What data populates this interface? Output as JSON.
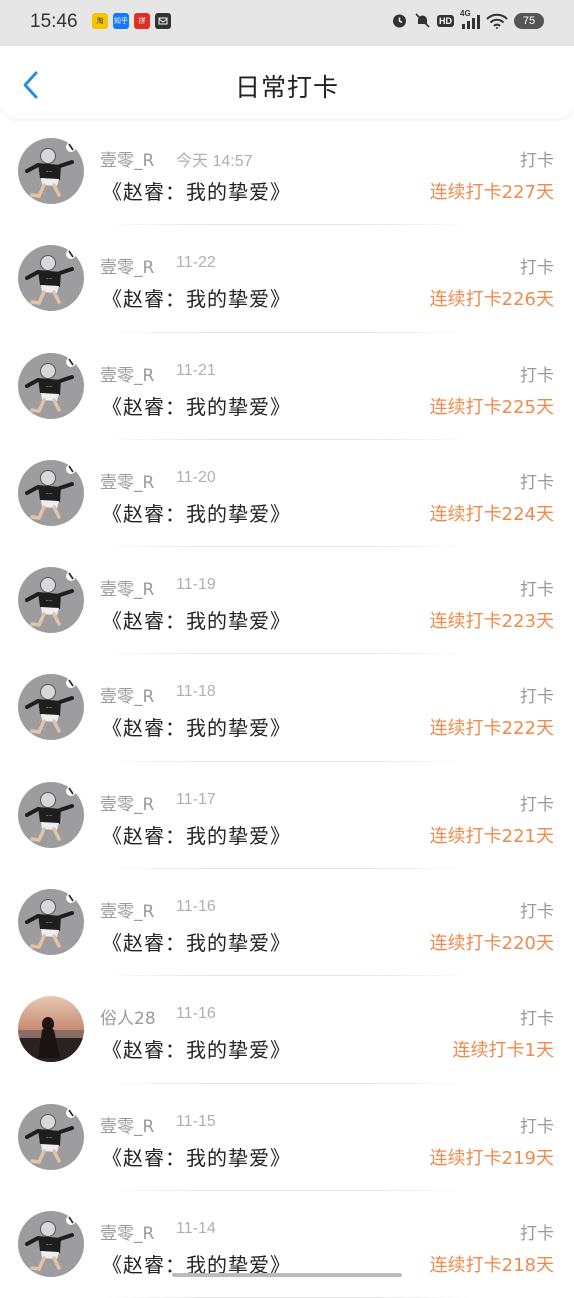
{
  "status_bar": {
    "time": "15:46",
    "battery": "75",
    "network": "4G",
    "hd": "HD",
    "notifications": [
      {
        "icon": "taobao-icon",
        "color": "#f5c400",
        "label": "淘"
      },
      {
        "icon": "zhihu-icon",
        "color": "#1677ff",
        "label": "知乎"
      },
      {
        "icon": "pinduoduo-icon",
        "color": "#e02e24",
        "label": "拼"
      },
      {
        "icon": "app-icon",
        "color": "#333333",
        "label": ""
      }
    ]
  },
  "header": {
    "title": "日常打卡",
    "back_icon": "chevron-left-icon",
    "accent_color": "#2a8ee0"
  },
  "checkins": [
    {
      "user": "壹零_R",
      "time": "今天 14:57",
      "label": "打卡",
      "book": "《赵睿：我的挚爱》",
      "streak": "连续打卡227天",
      "avatar": "avatar-figure"
    },
    {
      "user": "壹零_R",
      "time": "11-22",
      "label": "打卡",
      "book": "《赵睿：我的挚爱》",
      "streak": "连续打卡226天",
      "avatar": "avatar-figure"
    },
    {
      "user": "壹零_R",
      "time": "11-21",
      "label": "打卡",
      "book": "《赵睿：我的挚爱》",
      "streak": "连续打卡225天",
      "avatar": "avatar-figure"
    },
    {
      "user": "壹零_R",
      "time": "11-20",
      "label": "打卡",
      "book": "《赵睿：我的挚爱》",
      "streak": "连续打卡224天",
      "avatar": "avatar-figure"
    },
    {
      "user": "壹零_R",
      "time": "11-19",
      "label": "打卡",
      "book": "《赵睿：我的挚爱》",
      "streak": "连续打卡223天",
      "avatar": "avatar-figure"
    },
    {
      "user": "壹零_R",
      "time": "11-18",
      "label": "打卡",
      "book": "《赵睿：我的挚爱》",
      "streak": "连续打卡222天",
      "avatar": "avatar-figure"
    },
    {
      "user": "壹零_R",
      "time": "11-17",
      "label": "打卡",
      "book": "《赵睿：我的挚爱》",
      "streak": "连续打卡221天",
      "avatar": "avatar-figure"
    },
    {
      "user": "壹零_R",
      "time": "11-16",
      "label": "打卡",
      "book": "《赵睿：我的挚爱》",
      "streak": "连续打卡220天",
      "avatar": "avatar-figure"
    },
    {
      "user": "俗人28",
      "time": "11-16",
      "label": "打卡",
      "book": "《赵睿：我的挚爱》",
      "streak": "连续打卡1天",
      "avatar": "avatar-sunset"
    },
    {
      "user": "壹零_R",
      "time": "11-15",
      "label": "打卡",
      "book": "《赵睿：我的挚爱》",
      "streak": "连续打卡219天",
      "avatar": "avatar-figure"
    },
    {
      "user": "壹零_R",
      "time": "11-14",
      "label": "打卡",
      "book": "《赵睿：我的挚爱》",
      "streak": "连续打卡218天",
      "avatar": "avatar-figure"
    }
  ],
  "colors": {
    "streak": "#f08a4b",
    "muted_text": "#9a9a9a",
    "status_bar_bg": "#e6e6e6"
  }
}
